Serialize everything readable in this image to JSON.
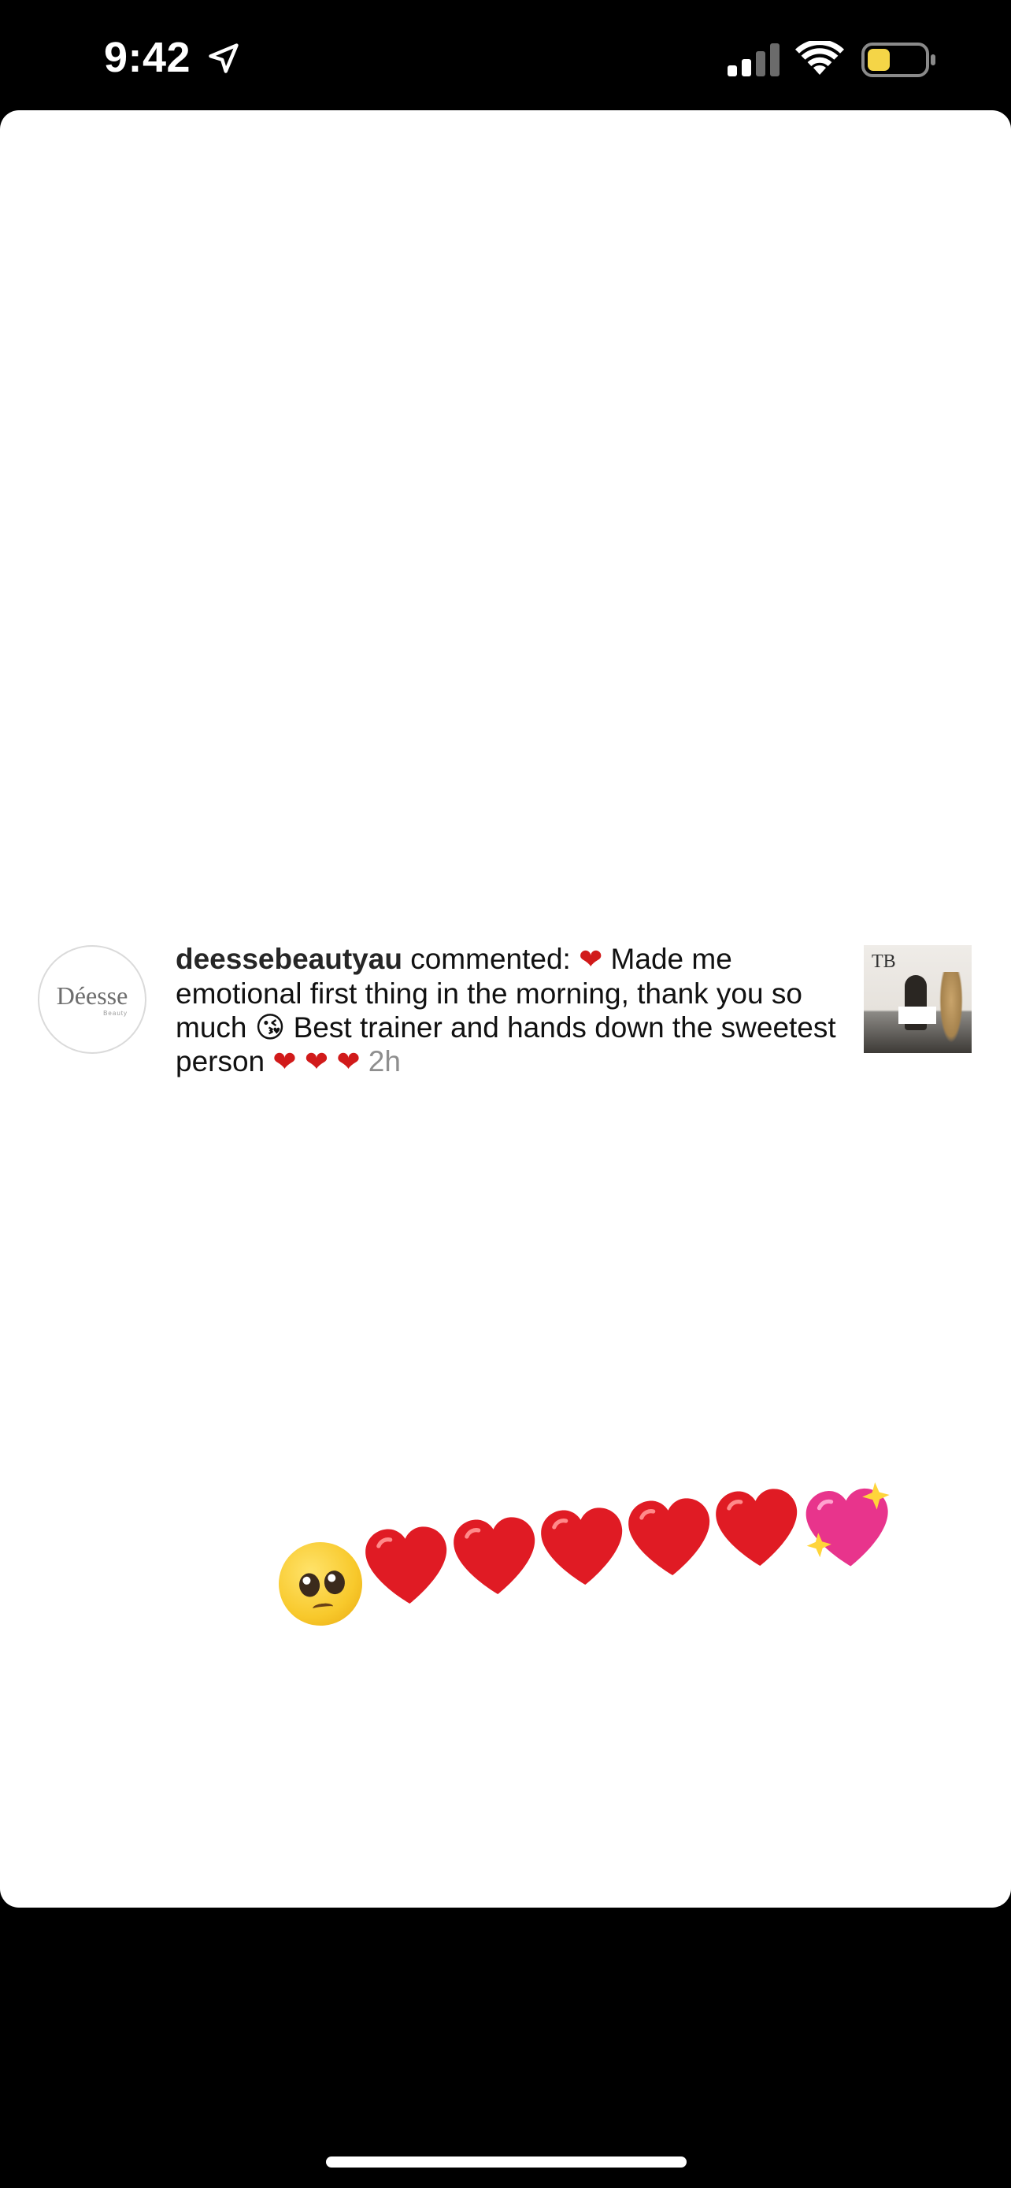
{
  "status_bar": {
    "time": "9:42",
    "icons": [
      "location-arrow-icon",
      "cellular-signal-icon",
      "wifi-icon",
      "battery-icon"
    ],
    "battery_color": "#f5d547"
  },
  "comment": {
    "username": "deessebeautyau",
    "action": "commented:",
    "text_part1": "Made me emotional first thing in the morning, thank you so much",
    "text_part2": "Best trainer and hands down the sweetest person",
    "emoji_heart": "❤",
    "emoji_kiss": "😘",
    "time_ago": "2h",
    "avatar": {
      "brand": "Déesse",
      "sub": "Beauty"
    },
    "thumbnail_logo": "TB"
  },
  "sticker": {
    "icons": [
      "pleading-face-icon",
      "red-heart-icon",
      "red-heart-icon",
      "red-heart-icon",
      "red-heart-icon",
      "red-heart-icon",
      "sparkling-heart-icon"
    ]
  },
  "colors": {
    "heart_red": "#e01b24",
    "sparkling_heart": "#e8348c",
    "background": "#000000",
    "card": "#ffffff"
  }
}
